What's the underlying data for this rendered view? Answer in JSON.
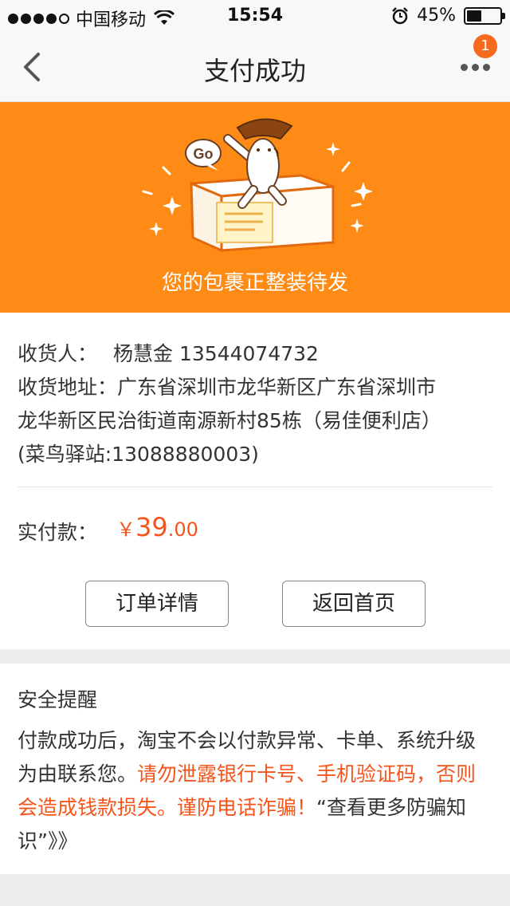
{
  "status_bar": {
    "carrier": "中国移动",
    "time": "15:54",
    "battery": "45%",
    "battery_level": 0.45
  },
  "nav": {
    "title": "支付成功",
    "badge_count": "1"
  },
  "banner": {
    "bubble_text": "Go",
    "message": "您的包裹正整装待发"
  },
  "order": {
    "receiver_label": "收货人：",
    "receiver_name": "杨慧金",
    "receiver_phone": "13544074732",
    "address_label": "收货地址：",
    "address_line1": "广东省深圳市龙华新区广东省深圳市",
    "address_line2": "龙华新区民治街道南源新村85栋（易佳便利店）",
    "address_line3": "(菜鸟驿站:13088880003)",
    "paid_label": "实付款：",
    "currency": "￥",
    "amount_int": "39",
    "amount_dec": ".00",
    "btn_detail": "订单详情",
    "btn_home": "返回首页"
  },
  "safety": {
    "title": "安全提醒",
    "text_1": "付款成功后，淘宝不会以付款异常、卡单、系统升级为由联系您。",
    "text_warn": "请勿泄露银行卡号、手机验证码，否则会造成钱款损失。谨防电话诈骗！",
    "text_link": "“查看更多防骗知识”》》"
  },
  "colors": {
    "accent": "#fd8b15",
    "price": "#f5541b",
    "badge": "#f56a1c"
  }
}
